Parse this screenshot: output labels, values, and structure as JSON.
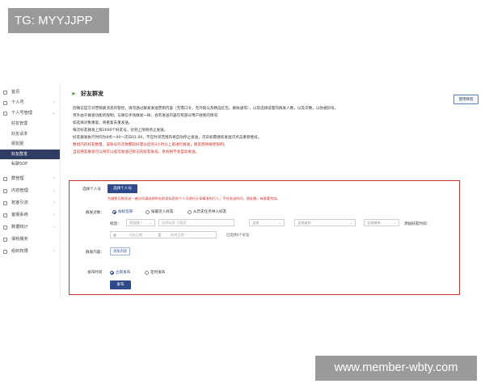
{
  "watermark": {
    "top": "TG: MYYJJPP",
    "bottom": "www.member-wbty.com"
  },
  "sidebar": {
    "items": [
      {
        "label": "首页",
        "has_arrow": false
      },
      {
        "label": "个人号",
        "has_arrow": true
      },
      {
        "label": "个人号管理",
        "has_arrow": true
      }
    ],
    "sub_items": [
      {
        "label": "好友管理",
        "active": false
      },
      {
        "label": "好友请求",
        "active": false
      },
      {
        "label": "朋友圈",
        "active": false
      },
      {
        "label": "好友群发",
        "active": true
      },
      {
        "label": "私聊SOP",
        "active": false
      }
    ],
    "bottom_items": [
      {
        "label": "群管理",
        "has_arrow": true
      },
      {
        "label": "内容管理",
        "has_arrow": true
      },
      {
        "label": "拓客引流",
        "has_arrow": true
      },
      {
        "label": "客服系统",
        "has_arrow": true
      },
      {
        "label": "数据统计",
        "has_arrow": true
      },
      {
        "label": "保粉服务",
        "has_arrow": false
      },
      {
        "label": "组织权限",
        "has_arrow": true
      }
    ]
  },
  "header": {
    "title": "好友群发",
    "help_button": "使用教程"
  },
  "notes": [
    {
      "text": "因微信官方对营销类消息的管控，请勿通过群发发送营销内容（无需口令，无外链以及精选红包，群收通等），以及选择适量的群发人数，以及次数，以防被封号。",
      "red": false
    },
    {
      "text": "另外由于群发功能的限制，与微信手动群发一样，会有发送内容仅有部分用户收到的情况",
      "red": false
    },
    {
      "text": "如选择对象重复，将重复去重发送。",
      "red": false
    },
    {
      "text": "每次好友群发上限2000个好友号，达到上限将停止发送。",
      "red": false
    },
    {
      "text": "好友群发执行时间为8点～00～次日01:00，不在时间范围内将自动停止发送，次日如需继续发送可点击重新继续。",
      "red": false
    },
    {
      "text": "数组内的好友数量，该账号的次数都较好量以后的3小时以上再进行群发，朋友圈将被拒限制。",
      "red": true
    },
    {
      "text": "当前朋友群发可以将可以提前发送已标记的好友账号，系统将不会自动发送。",
      "red": true
    }
  ],
  "form": {
    "select_account_label": "选择个人号",
    "select_account_button": "选择个人号",
    "select_account_hint": "为避免可能发送一遍访问请选择所在群发标签的个人号进行分享精准的打入，不在发送时间，朋友圈，有意要完成。",
    "target_label": "群发对象：",
    "target_options": [
      {
        "label": "按标签筛",
        "on": true
      },
      {
        "label": "按最近入好友",
        "on": false
      },
      {
        "label": "从历史任务导入好友",
        "on": false
      }
    ],
    "tag_label": "标签：",
    "tag_select": "包含其一",
    "tag_input": "选择标签 可搜索",
    "filters": [
      "全部",
      "全部省份",
      "全部城市"
    ],
    "add_time_label": "添加好友时间：",
    "date_placeholder_start": "开始日期",
    "date_sep": "至",
    "date_placeholder_end": "结束日期",
    "selected_count": "已选择0个好友",
    "content_label": "群发内容：",
    "add_content_button": "添加内容",
    "time_label": "发布时间",
    "time_options": [
      {
        "label": "立即发布",
        "on": true
      },
      {
        "label": "定时发布",
        "on": false
      }
    ],
    "publish_button": "发布"
  }
}
